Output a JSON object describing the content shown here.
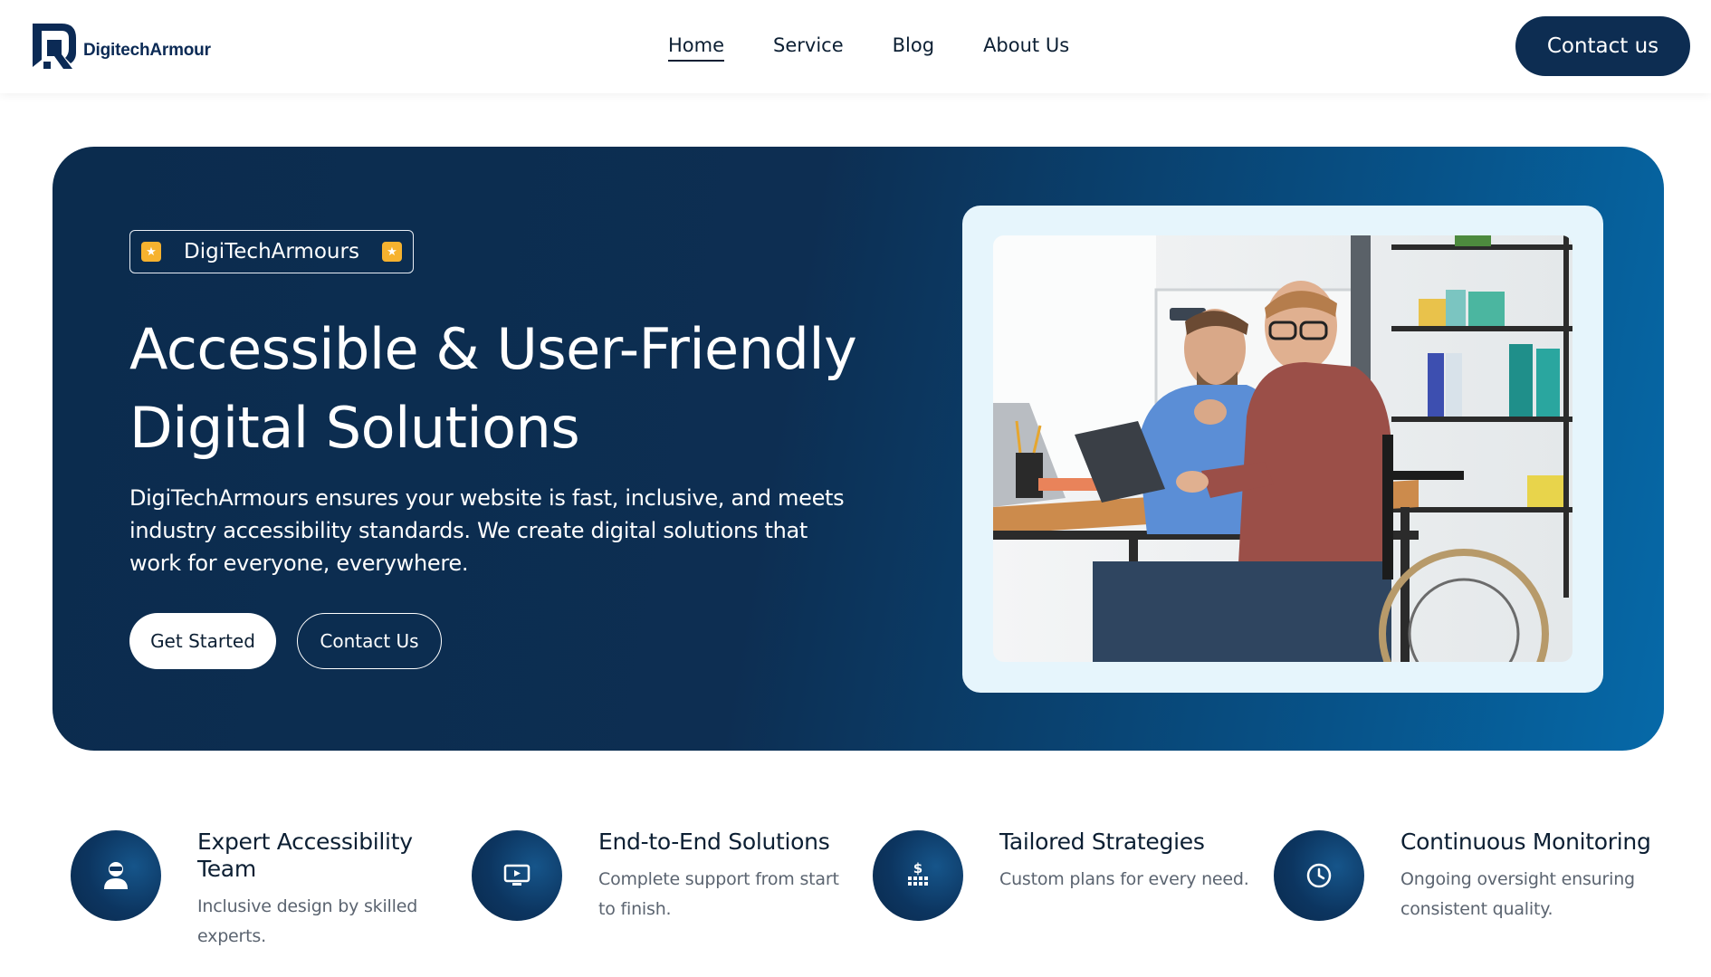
{
  "header": {
    "logo_text": "DigitechArmour",
    "nav": [
      {
        "label": "Home",
        "active": true
      },
      {
        "label": "Service",
        "active": false
      },
      {
        "label": "Blog",
        "active": false
      },
      {
        "label": "About Us",
        "active": false
      }
    ],
    "contact_label": "Contact us"
  },
  "hero": {
    "badge": "DigiTechArmours",
    "title_line1": "Accessible & User-Friendly",
    "title_line2": "Digital Solutions",
    "description": "DigiTechArmours ensures your website is fast, inclusive, and meets industry accessibility standards. We create digital solutions that work for everyone, everywhere.",
    "primary_button": "Get Started",
    "secondary_button": "Contact Us",
    "image_icon": "office-accessibility-photo"
  },
  "features": [
    {
      "icon": "user-icon",
      "title": "Expert Accessibility Team",
      "desc": "Inclusive design by skilled experts."
    },
    {
      "icon": "monitor-play-icon",
      "title": "End-to-End Solutions",
      "desc": "Complete support from start to finish."
    },
    {
      "icon": "dollar-icon",
      "title": "Tailored Strategies",
      "desc": "Custom plans for every need."
    },
    {
      "icon": "clock-icon",
      "title": "Continuous Monitoring",
      "desc": "Ongoing oversight ensuring consistent quality."
    }
  ],
  "colors": {
    "brand_dark": "#0d2d52",
    "hero_gradient_end": "#0669a8",
    "star": "#f6b22f"
  }
}
